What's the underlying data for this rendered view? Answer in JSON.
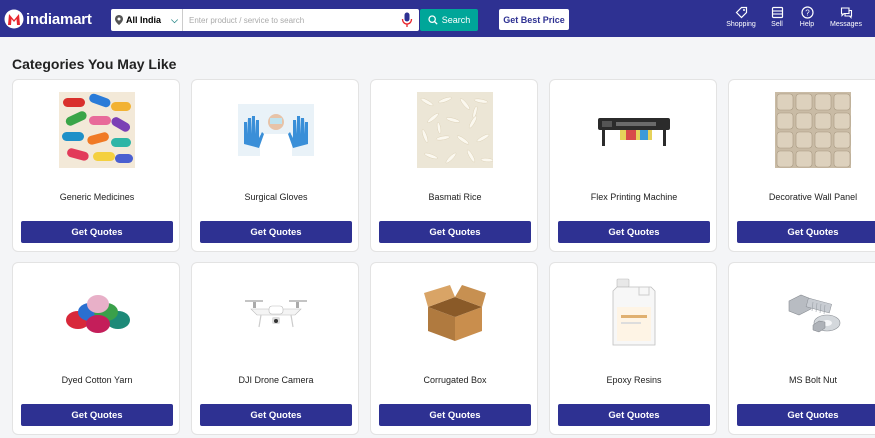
{
  "header": {
    "logo_text": "indiamart",
    "location": "All India",
    "search_placeholder": "Enter product / service to search",
    "search_label": "Search",
    "best_price_label": "Get Best Price",
    "nav": [
      {
        "label": "Shopping",
        "icon": "tag-icon"
      },
      {
        "label": "Sell",
        "icon": "store-icon"
      },
      {
        "label": "Help",
        "icon": "help-icon"
      },
      {
        "label": "Messages",
        "icon": "chat-icon"
      }
    ],
    "colors": {
      "bar": "#2e3192",
      "search_button": "#00a699",
      "logo_accent": "#e8262e"
    }
  },
  "main": {
    "title": "Categories You May Like",
    "button_label": "Get Quotes",
    "categories": [
      {
        "name": "Generic Medicines",
        "image": "capsules-image"
      },
      {
        "name": "Surgical Gloves",
        "image": "gloves-image"
      },
      {
        "name": "Basmati Rice",
        "image": "rice-image"
      },
      {
        "name": "Flex Printing Machine",
        "image": "printer-image"
      },
      {
        "name": "Decorative Wall Panel",
        "image": "wall-panel-image"
      },
      {
        "name": "Dyed Cotton Yarn",
        "image": "yarn-image"
      },
      {
        "name": "DJI Drone Camera",
        "image": "drone-image"
      },
      {
        "name": "Corrugated Box",
        "image": "box-image"
      },
      {
        "name": "Epoxy Resins",
        "image": "resin-jar-image"
      },
      {
        "name": "MS Bolt Nut",
        "image": "bolt-nut-image"
      }
    ]
  }
}
